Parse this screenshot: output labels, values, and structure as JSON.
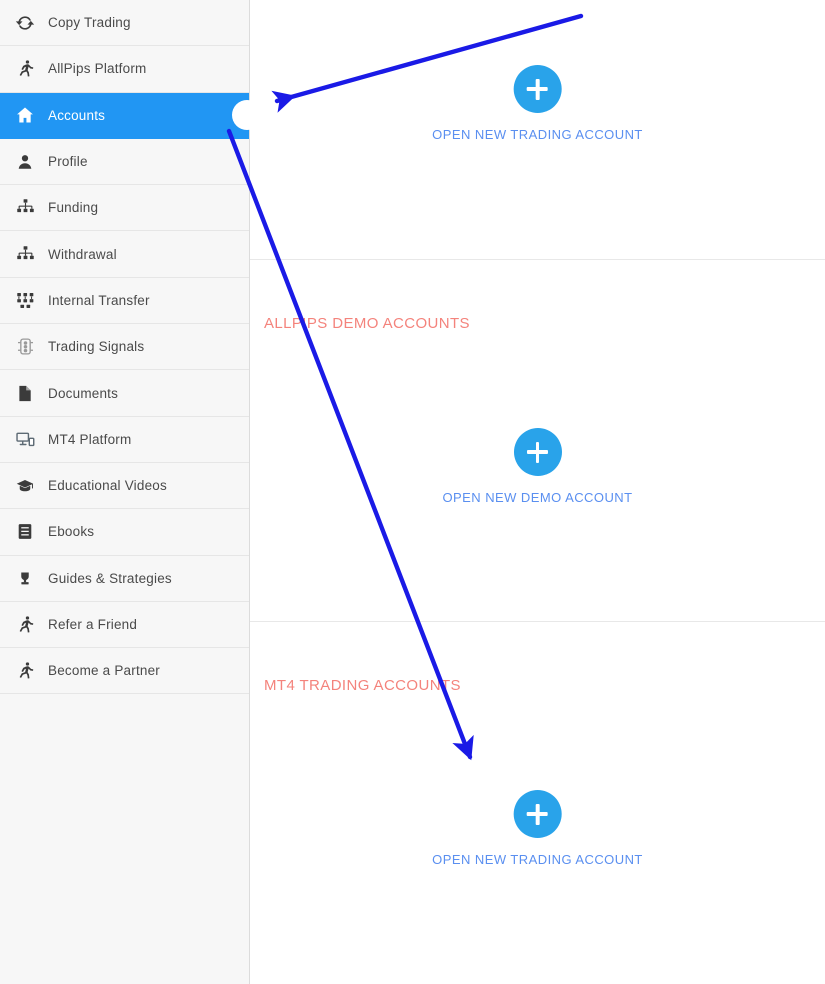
{
  "colors": {
    "accent_blue": "#2196f3",
    "button_blue": "#29a3ea",
    "link_blue": "#5a8ff0",
    "heading_red": "#f4837c",
    "sidebar_bg": "#f7f7f7",
    "annotation_blue": "#1a1ae6"
  },
  "sidebar": {
    "items": [
      {
        "label": "Copy Trading",
        "icon": "refresh-circle-icon",
        "active": false
      },
      {
        "label": "AllPips Platform",
        "icon": "running-person-icon",
        "active": false
      },
      {
        "label": "Accounts",
        "icon": "home-icon",
        "active": true
      },
      {
        "label": "Profile",
        "icon": "user-icon",
        "active": false
      },
      {
        "label": "Funding",
        "icon": "sitemap-icon",
        "active": false
      },
      {
        "label": "Withdrawal",
        "icon": "sitemap-icon",
        "active": false
      },
      {
        "label": "Internal Transfer",
        "icon": "transfer-icon",
        "active": false
      },
      {
        "label": "Trading Signals",
        "icon": "traffic-light-icon",
        "active": false
      },
      {
        "label": "Documents",
        "icon": "document-icon",
        "active": false
      },
      {
        "label": "MT4 Platform",
        "icon": "desktop-mobile-icon",
        "active": false
      },
      {
        "label": "Educational Videos",
        "icon": "graduation-cap-icon",
        "active": false
      },
      {
        "label": "Ebooks",
        "icon": "book-icon",
        "active": false
      },
      {
        "label": "Guides & Strategies",
        "icon": "trophy-icon",
        "active": false
      },
      {
        "label": "Refer a Friend",
        "icon": "running-person-icon",
        "active": false
      },
      {
        "label": "Become a Partner",
        "icon": "running-person-icon",
        "active": false
      }
    ]
  },
  "main": {
    "sections": [
      {
        "heading": "",
        "action_label": "OPEN NEW TRADING ACCOUNT",
        "action_icon": "plus-icon"
      },
      {
        "heading": "ALLPIPS DEMO ACCOUNTS",
        "action_label": "OPEN NEW DEMO ACCOUNT",
        "action_icon": "plus-icon"
      },
      {
        "heading": "MT4 TRADING ACCOUNTS",
        "action_label": "OPEN NEW TRADING ACCOUNT",
        "action_icon": "plus-icon"
      }
    ]
  },
  "annotations": {
    "arrow_1": {
      "name": "arrow-to-accounts",
      "points_to": "Accounts"
    },
    "arrow_2": {
      "name": "arrow-to-open-trading-account",
      "points_to": "OPEN NEW TRADING ACCOUNT"
    }
  }
}
